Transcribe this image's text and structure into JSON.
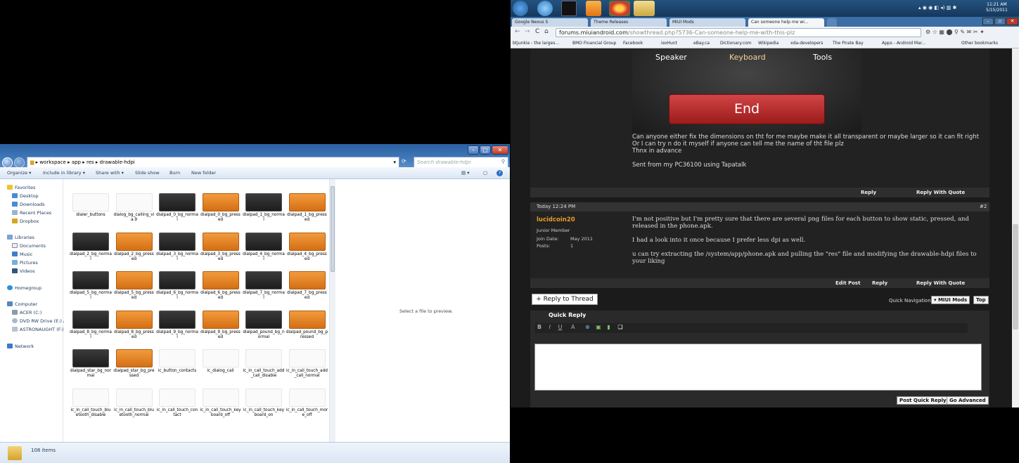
{
  "explorer": {
    "breadcrumb": [
      "workspace",
      "app",
      "res",
      "drawable-hdpi"
    ],
    "search_placeholder": "Search drawable-hdpi",
    "toolbar": [
      "Organize ▾",
      "Include in library ▾",
      "Share with ▾",
      "Slide show",
      "Burn",
      "New folder"
    ],
    "nav": {
      "favorites_header": "Favorites",
      "favorites": [
        "Desktop",
        "Downloads",
        "Recent Places",
        "Dropbox"
      ],
      "libraries_header": "Libraries",
      "libraries": [
        "Documents",
        "Music",
        "Pictures",
        "Videos"
      ],
      "homegroup": "Homegroup",
      "computer_header": "Computer",
      "computer": [
        "ACER (C:)",
        "DVD RW Drive (E:) A",
        "ASTRONAUGHT (F:)"
      ],
      "network": "Network"
    },
    "files": [
      {
        "name": "dialer_buttons",
        "thumb": "light"
      },
      {
        "name": "dialog_bg_calling_via.9",
        "thumb": "light"
      },
      {
        "name": "dialpad_0_bg_normal",
        "thumb": "dark"
      },
      {
        "name": "dialpad_0_bg_pressed",
        "thumb": "orange"
      },
      {
        "name": "dialpad_1_bg_normal",
        "thumb": "dark"
      },
      {
        "name": "dialpad_1_bg_pressed",
        "thumb": "orange"
      },
      {
        "name": "dialpad_2_bg_normal",
        "thumb": "dark"
      },
      {
        "name": "dialpad_2_bg_pressed",
        "thumb": "orange"
      },
      {
        "name": "dialpad_3_bg_normal",
        "thumb": "dark"
      },
      {
        "name": "dialpad_3_bg_pressed",
        "thumb": "orange"
      },
      {
        "name": "dialpad_4_bg_normal",
        "thumb": "dark"
      },
      {
        "name": "dialpad_4_bg_pressed",
        "thumb": "orange"
      },
      {
        "name": "dialpad_5_bg_normal",
        "thumb": "dark"
      },
      {
        "name": "dialpad_5_bg_pressed",
        "thumb": "orange"
      },
      {
        "name": "dialpad_6_bg_normal",
        "thumb": "dark"
      },
      {
        "name": "dialpad_6_bg_pressed",
        "thumb": "orange"
      },
      {
        "name": "dialpad_7_bg_normal",
        "thumb": "dark"
      },
      {
        "name": "dialpad_7_bg_pressed",
        "thumb": "orange"
      },
      {
        "name": "dialpad_8_bg_normal",
        "thumb": "dark"
      },
      {
        "name": "dialpad_8_bg_pressed",
        "thumb": "orange"
      },
      {
        "name": "dialpad_9_bg_normal",
        "thumb": "dark"
      },
      {
        "name": "dialpad_9_bg_pressed",
        "thumb": "orange"
      },
      {
        "name": "dialpad_pound_bg_normal",
        "thumb": "dark"
      },
      {
        "name": "dialpad_pound_bg_pressed",
        "thumb": "orange"
      },
      {
        "name": "dialpad_star_bg_normal",
        "thumb": "dark"
      },
      {
        "name": "dialpad_star_bg_pressed",
        "thumb": "orange"
      },
      {
        "name": "ic_button_contacts",
        "thumb": "light"
      },
      {
        "name": "ic_dialog_call",
        "thumb": "light"
      },
      {
        "name": "ic_in_call_touch_add_call_disable",
        "thumb": "light"
      },
      {
        "name": "ic_in_call_touch_add_call_normal",
        "thumb": "light"
      },
      {
        "name": "ic_in_call_touch_bluetooth_disable",
        "thumb": "light"
      },
      {
        "name": "ic_in_call_touch_bluetooth_normal",
        "thumb": "light"
      },
      {
        "name": "ic_in_call_touch_contact",
        "thumb": "light"
      },
      {
        "name": "ic_in_call_touch_keyboard_off",
        "thumb": "light"
      },
      {
        "name": "ic_in_call_touch_keyboard_on",
        "thumb": "light"
      },
      {
        "name": "ic_in_call_touch_more_off",
        "thumb": "light"
      }
    ],
    "preview_text": "Select a file to preview.",
    "item_count": "108 items"
  },
  "browser": {
    "clock_time": "11:21 AM",
    "clock_date": "5/15/2011",
    "tabs": [
      "Google Nexus S",
      "Theme Releases",
      "MIUI Mods",
      "Can someone help me wi..."
    ],
    "url_host": "forums.miuiandroid.com",
    "url_path": "/showthread.php?5736-Can-someone-help-me-with-this-plz",
    "bookmarks": [
      "btjunkie - the larges...",
      "BMO Financial Group",
      "Facebook",
      "isoHunt",
      "eBay.ca",
      "Dictionary.com",
      "Wikipedia",
      "xda-developers",
      "The Pirate Bay",
      "Apps - Android Mar...",
      "Other bookmarks"
    ],
    "phone_labels": [
      "Speaker",
      "Keyboard",
      "Tools"
    ],
    "end_label": "End",
    "post1_lines": [
      "Can anyone either fix the dimensions on tht for me maybe make it all transparent or maybe larger so it can fit right",
      "Or I can try n do it myself if anyone can tell me the name of tht file plz",
      "Thnx in advance",
      "",
      "Sent from my PC36100 using Tapatalk"
    ],
    "post1_actions": [
      "Reply",
      "Reply With Quote"
    ],
    "post2": {
      "date": "Today 12:24 PM",
      "number": "#2",
      "username": "lucidcoin20",
      "rank": "Junior Member",
      "join_label": "Join Date:",
      "join_value": "May 2011",
      "posts_label": "Posts:",
      "posts_value": "1",
      "lines": [
        "I'm not positive but I'm pretty sure that there are several png files for each button to show static, pressed, and released in the phone.apk.",
        "I had a look into it once because I prefer less dpi as well.",
        "u can try extracting the /system/app/phone.apk and pulling the \"res\" file and modifying the drawable-hdpi files to your liking"
      ],
      "actions": [
        "Edit Post",
        "Reply",
        "Reply With Quote"
      ]
    },
    "reply_thread": "+ Reply to Thread",
    "quick_nav_label": "Quick Navigation",
    "quick_nav_value": "▾ MIUI Mods",
    "top_label": "Top",
    "quick_reply_title": "Quick Reply",
    "post_quick_reply": "Post Quick Reply",
    "go_advanced": "Go Advanced"
  }
}
